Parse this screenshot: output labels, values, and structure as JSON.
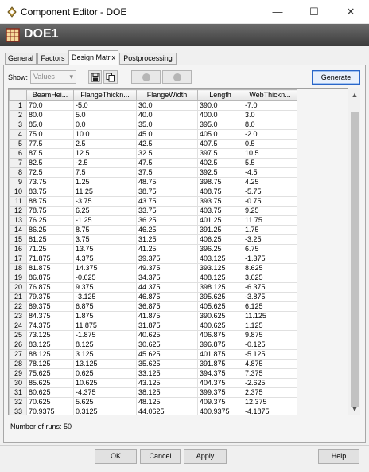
{
  "window": {
    "title": "Component Editor - DOE",
    "controls": {
      "minimize": "—",
      "maximize": "☐",
      "close": "✕"
    }
  },
  "header": {
    "name": "DOE1"
  },
  "tabs": [
    {
      "label": "General"
    },
    {
      "label": "Factors"
    },
    {
      "label": "Design Matrix",
      "active": true
    },
    {
      "label": "Postprocessing"
    }
  ],
  "toolbar": {
    "show_label": "Show:",
    "show_value": "Values",
    "generate_label": "Generate"
  },
  "table": {
    "columns": [
      "BeamHei...",
      "FlangeThickn...",
      "FlangeWidth",
      "Length",
      "WebThickn..."
    ],
    "rows": [
      [
        "1",
        "70.0",
        "-5.0",
        "30.0",
        "390.0",
        "-7.0"
      ],
      [
        "2",
        "80.0",
        "5.0",
        "40.0",
        "400.0",
        "3.0"
      ],
      [
        "3",
        "85.0",
        "0.0",
        "35.0",
        "395.0",
        "8.0"
      ],
      [
        "4",
        "75.0",
        "10.0",
        "45.0",
        "405.0",
        "-2.0"
      ],
      [
        "5",
        "77.5",
        "2.5",
        "42.5",
        "407.5",
        "0.5"
      ],
      [
        "6",
        "87.5",
        "12.5",
        "32.5",
        "397.5",
        "10.5"
      ],
      [
        "7",
        "82.5",
        "-2.5",
        "47.5",
        "402.5",
        "5.5"
      ],
      [
        "8",
        "72.5",
        "7.5",
        "37.5",
        "392.5",
        "-4.5"
      ],
      [
        "9",
        "73.75",
        "1.25",
        "48.75",
        "398.75",
        "4.25"
      ],
      [
        "10",
        "83.75",
        "11.25",
        "38.75",
        "408.75",
        "-5.75"
      ],
      [
        "11",
        "88.75",
        "-3.75",
        "43.75",
        "393.75",
        "-0.75"
      ],
      [
        "12",
        "78.75",
        "6.25",
        "33.75",
        "403.75",
        "9.25"
      ],
      [
        "13",
        "76.25",
        "-1.25",
        "36.25",
        "401.25",
        "11.75"
      ],
      [
        "14",
        "86.25",
        "8.75",
        "46.25",
        "391.25",
        "1.75"
      ],
      [
        "15",
        "81.25",
        "3.75",
        "31.25",
        "406.25",
        "-3.25"
      ],
      [
        "16",
        "71.25",
        "13.75",
        "41.25",
        "396.25",
        "6.75"
      ],
      [
        "17",
        "71.875",
        "4.375",
        "39.375",
        "403.125",
        "-1.375"
      ],
      [
        "18",
        "81.875",
        "14.375",
        "49.375",
        "393.125",
        "8.625"
      ],
      [
        "19",
        "86.875",
        "-0.625",
        "34.375",
        "408.125",
        "3.625"
      ],
      [
        "20",
        "76.875",
        "9.375",
        "44.375",
        "398.125",
        "-6.375"
      ],
      [
        "21",
        "79.375",
        "-3.125",
        "46.875",
        "395.625",
        "-3.875"
      ],
      [
        "22",
        "89.375",
        "6.875",
        "36.875",
        "405.625",
        "6.125"
      ],
      [
        "23",
        "84.375",
        "1.875",
        "41.875",
        "390.625",
        "11.125"
      ],
      [
        "24",
        "74.375",
        "11.875",
        "31.875",
        "400.625",
        "1.125"
      ],
      [
        "25",
        "73.125",
        "-1.875",
        "40.625",
        "406.875",
        "9.875"
      ],
      [
        "26",
        "83.125",
        "8.125",
        "30.625",
        "396.875",
        "-0.125"
      ],
      [
        "27",
        "88.125",
        "3.125",
        "45.625",
        "401.875",
        "-5.125"
      ],
      [
        "28",
        "78.125",
        "13.125",
        "35.625",
        "391.875",
        "4.875"
      ],
      [
        "29",
        "75.625",
        "0.625",
        "33.125",
        "394.375",
        "7.375"
      ],
      [
        "30",
        "85.625",
        "10.625",
        "43.125",
        "404.375",
        "-2.625"
      ],
      [
        "31",
        "80.625",
        "-4.375",
        "38.125",
        "399.375",
        "2.375"
      ],
      [
        "32",
        "70.625",
        "5.625",
        "48.125",
        "409.375",
        "12.375"
      ],
      [
        "33",
        "70.9375",
        "0.3125",
        "44.0625",
        "400.9375",
        "-4.1875"
      ]
    ]
  },
  "status": {
    "runs": "Number of runs: 50"
  },
  "footer": {
    "ok": "OK",
    "cancel": "Cancel",
    "apply": "Apply",
    "help": "Help"
  },
  "colors": {
    "header_band": "#4a4a4a",
    "generate_border": "#2a66c8"
  }
}
